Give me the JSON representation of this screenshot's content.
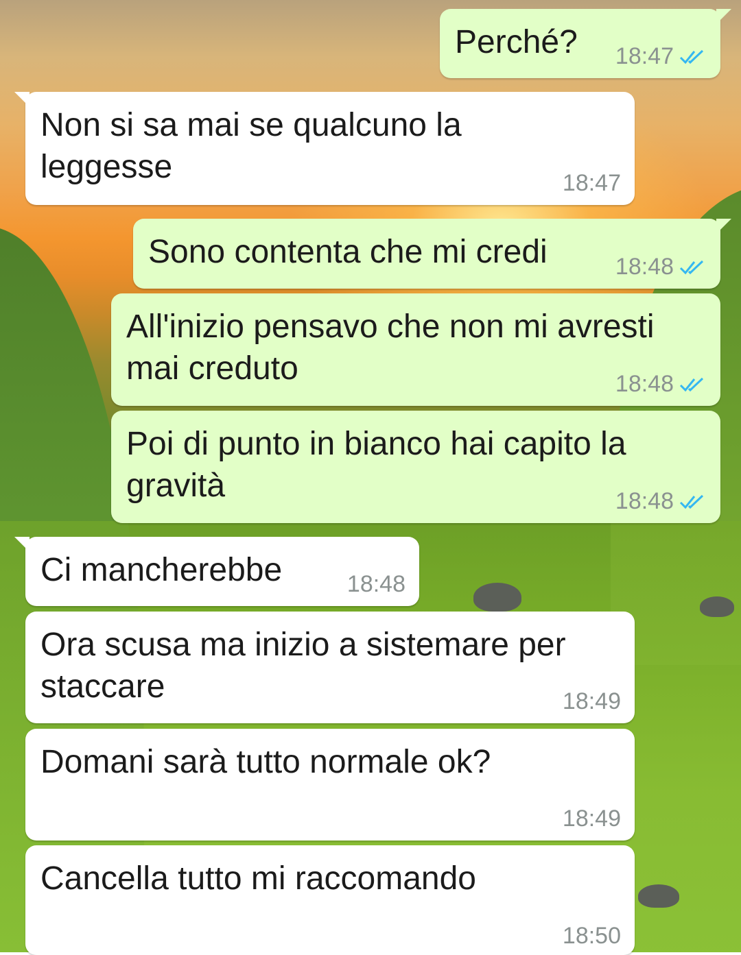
{
  "colors": {
    "incoming_bubble": "#ffffff",
    "outgoing_bubble": "#e2ffc7",
    "read_ticks": "#34b7f1",
    "timestamp": "#8a9190"
  },
  "messages": [
    {
      "text": "Perché?",
      "time": "18:47",
      "direction": "outgoing",
      "status": "read-double-check-icon"
    },
    {
      "text": "Non si sa mai se qualcuno la\nleggesse",
      "time": "18:47",
      "direction": "incoming"
    },
    {
      "text": "Sono contenta che mi credi",
      "time": "18:48",
      "direction": "outgoing",
      "status": "read-double-check-icon"
    },
    {
      "text": "All'inizio pensavo che non mi avresti\nmai creduto",
      "time": "18:48",
      "direction": "outgoing",
      "status": "read-double-check-icon"
    },
    {
      "text": "Poi di punto in bianco hai capito la\ngravità",
      "time": "18:48",
      "direction": "outgoing",
      "status": "read-double-check-icon"
    },
    {
      "text": "Ci mancherebbe",
      "time": "18:48",
      "direction": "incoming"
    },
    {
      "text": "Ora scusa ma inizio a sistemare per\nstaccare",
      "time": "18:49",
      "direction": "incoming"
    },
    {
      "text": "Domani sarà tutto normale ok?",
      "time": "18:49",
      "direction": "incoming"
    },
    {
      "text": "Cancella tutto mi raccomando",
      "time": "18:50",
      "direction": "incoming"
    }
  ]
}
